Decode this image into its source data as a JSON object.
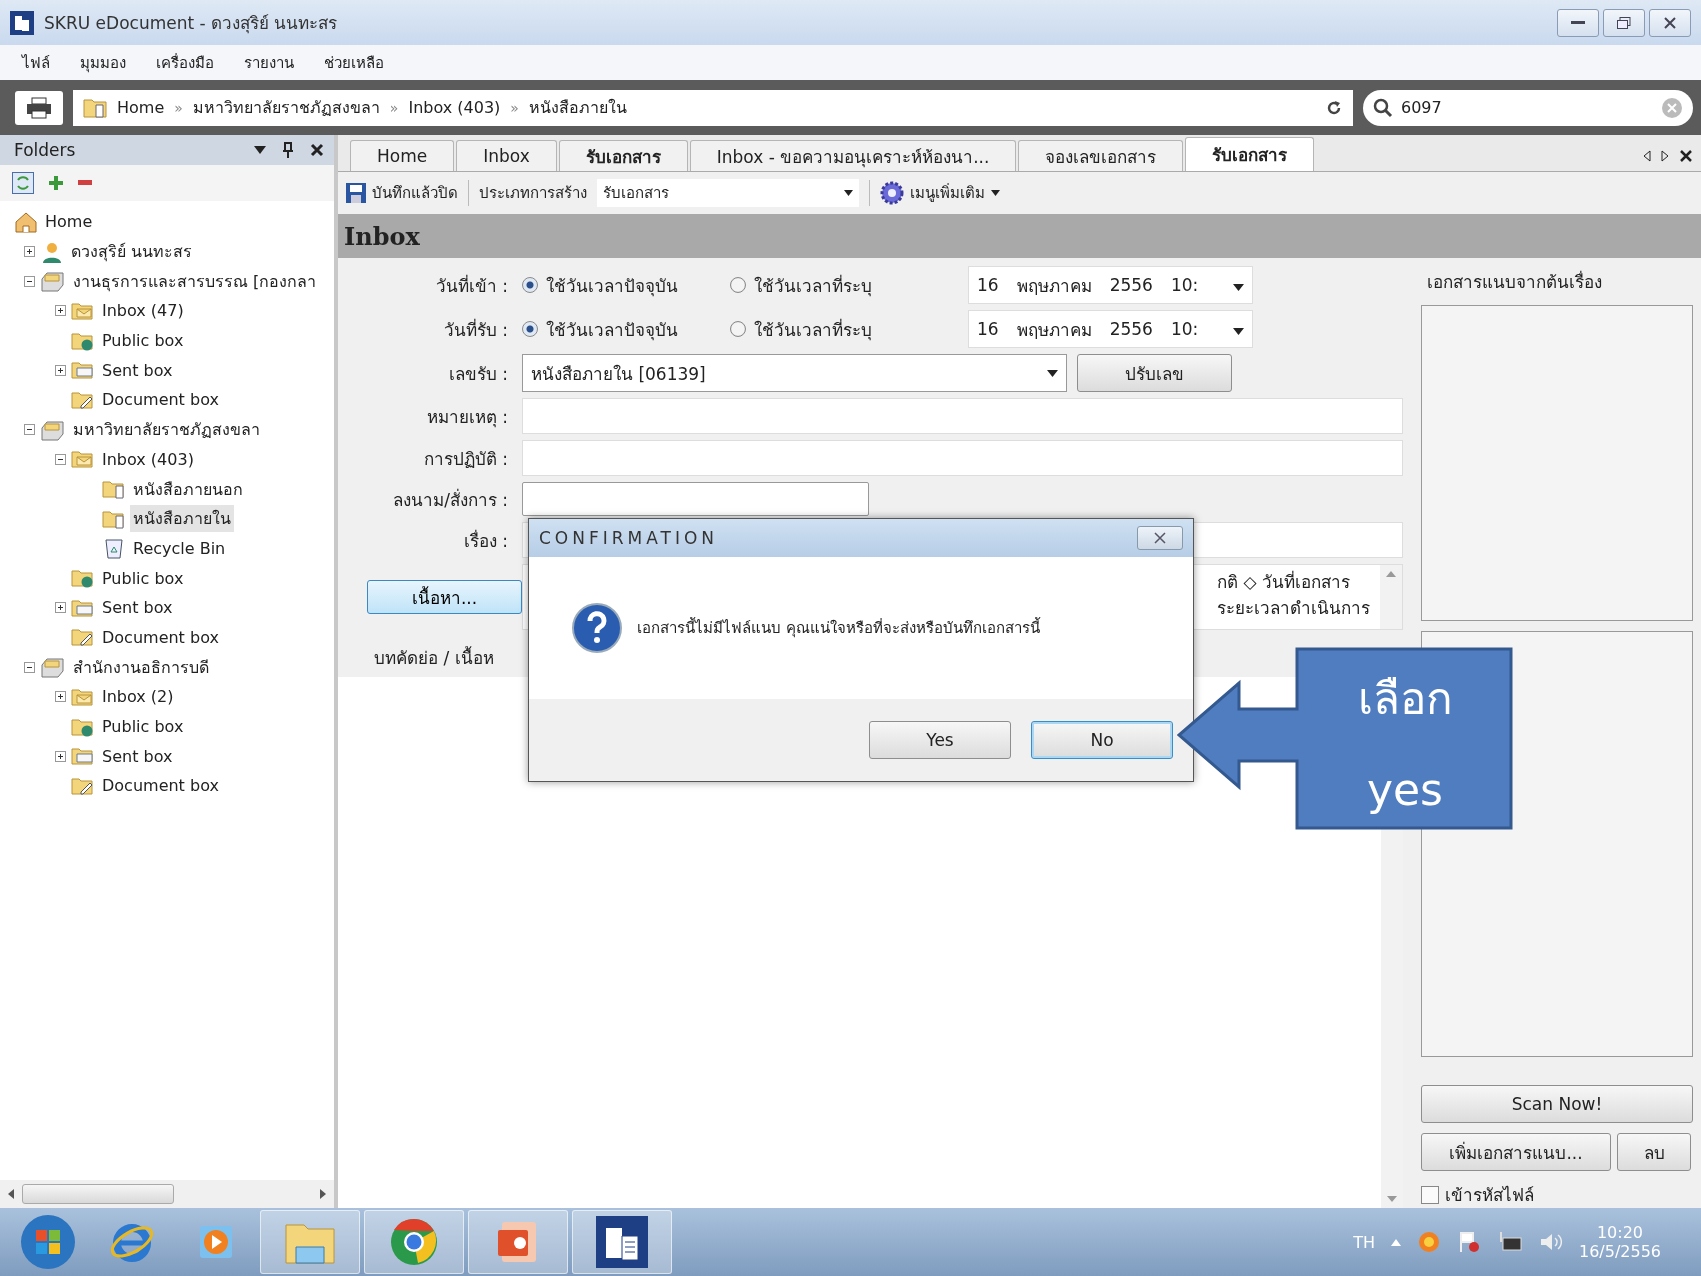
{
  "window": {
    "title": "SKRU eDocument - ดวงสุริย์ นนทะสร"
  },
  "menu": [
    "ไฟล์",
    "มุมมอง",
    "เครื่องมือ",
    "รายงาน",
    "ช่วยเหลือ"
  ],
  "address_bar": {
    "breadcrumb": [
      "Home",
      "มหาวิทยาลัยราชภัฏสงขลา",
      "Inbox (403)",
      "หนังสือภายใน"
    ],
    "separator": "»",
    "search_value": "6097"
  },
  "folders": {
    "title": "Folders",
    "tree": [
      {
        "label": "Home",
        "kind": "home",
        "selected": false,
        "children": [
          {
            "label": "ดวงสุริย์ นนทะสร",
            "kind": "user",
            "selected": false,
            "expanded": false
          },
          {
            "label": "งานธุรการและสารบรรณ [กองกลา",
            "kind": "cabinet",
            "selected": false,
            "expanded": true,
            "children": [
              {
                "label": "Inbox (47)",
                "kind": "inbox",
                "selected": false,
                "expanded": false
              },
              {
                "label": "Public box",
                "kind": "public",
                "selected": false
              },
              {
                "label": "Sent box",
                "kind": "sent",
                "selected": false,
                "expanded": false
              },
              {
                "label": "Document box",
                "kind": "document",
                "selected": false
              }
            ]
          },
          {
            "label": "มหาวิทยาลัยราชภัฏสงขลา",
            "kind": "cabinet",
            "selected": false,
            "expanded": true,
            "children": [
              {
                "label": "Inbox (403)",
                "kind": "inbox",
                "selected": false,
                "expanded": true,
                "children": [
                  {
                    "label": "หนังสือภายนอก",
                    "kind": "subfolder",
                    "selected": false
                  },
                  {
                    "label": "หนังสือภายใน",
                    "kind": "subfolder",
                    "selected": true
                  },
                  {
                    "label": "Recycle Bin",
                    "kind": "recycle",
                    "selected": false
                  }
                ]
              },
              {
                "label": "Public box",
                "kind": "public",
                "selected": false
              },
              {
                "label": "Sent box",
                "kind": "sent",
                "selected": false,
                "expanded": false
              },
              {
                "label": "Document box",
                "kind": "document",
                "selected": false
              }
            ]
          },
          {
            "label": "สำนักงานอธิการบดี",
            "kind": "cabinet",
            "selected": false,
            "expanded": true,
            "children": [
              {
                "label": "Inbox (2)",
                "kind": "inbox",
                "selected": false,
                "expanded": false
              },
              {
                "label": "Public box",
                "kind": "public",
                "selected": false
              },
              {
                "label": "Sent box",
                "kind": "sent",
                "selected": false,
                "expanded": false
              },
              {
                "label": "Document box",
                "kind": "document",
                "selected": false
              }
            ]
          }
        ]
      }
    ]
  },
  "tabs": [
    {
      "label": "Home",
      "selected": false,
      "bold": false
    },
    {
      "label": "Inbox",
      "selected": false,
      "bold": false
    },
    {
      "label": "รับเอกสาร",
      "selected": false,
      "bold": true
    },
    {
      "label": "Inbox - ขอความอนุเคราะห์ห้องนา...",
      "selected": false,
      "bold": false
    },
    {
      "label": "จองเลขเอกสาร",
      "selected": false,
      "bold": false
    },
    {
      "label": "รับเอกสาร",
      "selected": true,
      "bold": true
    }
  ],
  "toolbar": {
    "save": "บันทึกแล้วปิด",
    "type_label": "ประเภทการสร้าง",
    "type_value": "รับเอกสาร",
    "more": "เมนูเพิ่มเติม"
  },
  "section_title": "Inbox",
  "form": {
    "date_rows": [
      {
        "label": "วันที่เข้า :",
        "options": [
          {
            "label": "ใช้วันเวลาปัจจุบัน",
            "selected": true
          },
          {
            "label": "ใช้วันเวลาที่ระบุ",
            "selected": false
          }
        ],
        "date": [
          "16",
          "พฤษภาคม",
          "2556",
          "10:"
        ]
      },
      {
        "label": "วันที่รับ :",
        "options": [
          {
            "label": "ใช้วันเวลาปัจจุบัน",
            "selected": true
          },
          {
            "label": "ใช้วันเวลาที่ระบุ",
            "selected": false
          }
        ],
        "date": [
          "16",
          "พฤษภาคม",
          "2556",
          "10:"
        ]
      }
    ],
    "number_row": {
      "label": "เลขรับ :",
      "value": "หนังสือภายใน [06139]",
      "button": "ปรับเลข"
    },
    "text_rows": [
      {
        "label": "หมายเหตุ :"
      },
      {
        "label": "การปฏิบัติ :"
      }
    ],
    "sign_label": "ลงนาม/สั่งการ :",
    "subject_label": "เรื่อง :",
    "content_button": "เนื้อหา...",
    "info_lines": [
      "กติ ◇ วันที่เอกสาร",
      "ระยะเวลาดำเนินการ"
    ],
    "abstract_label": "บทคัดย่อ / เนื้อห"
  },
  "attachments": {
    "legend": "เอกสารแนบจากต้นเรื่อง",
    "scan": "Scan Now!",
    "add": "เพิ่มเอกสารแนบ...",
    "delete": "ลบ",
    "encrypt": {
      "label": "เข้ารหัสไฟล์",
      "checked": false
    }
  },
  "dialog": {
    "title": "CONFIRMATION",
    "message": "เอกสารนี้ไม่มีไฟล์แนบ คุณแน่ใจหรือที่จะส่งหรือบันทึกเอกสารนี้",
    "buttons": [
      {
        "label": "Yes",
        "focused": false
      },
      {
        "label": "No",
        "focused": true
      }
    ]
  },
  "callout": {
    "lines": [
      "เลือก",
      "yes"
    ]
  },
  "taskbar": {
    "apps": [
      {
        "kind": "start",
        "running": false
      },
      {
        "kind": "ie",
        "running": false
      },
      {
        "kind": "media",
        "running": false
      },
      {
        "kind": "explorer",
        "running": true
      },
      {
        "kind": "chrome",
        "running": true
      },
      {
        "kind": "powerpoint",
        "running": true
      },
      {
        "kind": "edoc",
        "running": true
      }
    ],
    "language": "TH",
    "time": "10:20",
    "date": "16/5/2556"
  }
}
